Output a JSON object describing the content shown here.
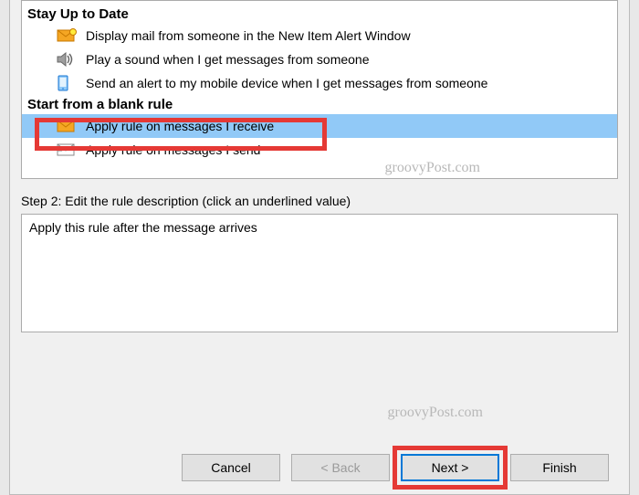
{
  "sections": {
    "stay_up_to_date": {
      "header": "Stay Up to Date",
      "items": [
        "Display mail from someone in the New Item Alert Window",
        "Play a sound when I get messages from someone",
        "Send an alert to my mobile device when I get messages from someone"
      ]
    },
    "blank_rule": {
      "header": "Start from a blank rule",
      "items": [
        "Apply rule on messages I receive",
        "Apply rule on messages I send"
      ]
    }
  },
  "step2_label": "Step 2: Edit the rule description (click an underlined value)",
  "description_text": "Apply this rule after the message arrives",
  "buttons": {
    "cancel": "Cancel",
    "back": "< Back",
    "next": "Next >",
    "finish": "Finish"
  },
  "watermark": "groovyPost.com"
}
